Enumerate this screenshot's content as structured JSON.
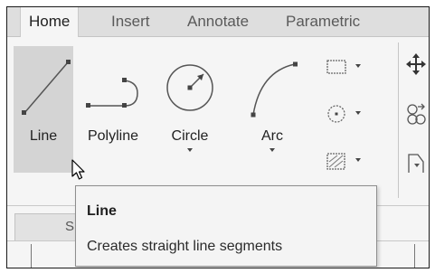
{
  "tabs": [
    {
      "label": "Home",
      "active": true
    },
    {
      "label": "Insert",
      "active": false
    },
    {
      "label": "Annotate",
      "active": false
    },
    {
      "label": "Parametric",
      "active": false
    }
  ],
  "draw_panel": {
    "tools": [
      {
        "label": "Line",
        "icon": "line-icon",
        "has_dropdown": false,
        "hovered": true
      },
      {
        "label": "Polyline",
        "icon": "polyline-icon",
        "has_dropdown": false,
        "hovered": false
      },
      {
        "label": "Circle",
        "icon": "circle-icon",
        "has_dropdown": true,
        "hovered": false
      },
      {
        "label": "Arc",
        "icon": "arc-icon",
        "has_dropdown": true,
        "hovered": false
      }
    ],
    "small_tools": [
      {
        "icon": "rectangle-icon",
        "has_dropdown": true
      },
      {
        "icon": "ellipse-icon",
        "has_dropdown": true
      },
      {
        "icon": "hatch-icon",
        "has_dropdown": true
      }
    ]
  },
  "modify_panel": {
    "icons": [
      "move-icon",
      "copy-icon",
      "stretch-icon"
    ]
  },
  "tooltip": {
    "title": "Line",
    "description": "Creates straight line segments"
  },
  "colors": {
    "ribbon_bg": "#f5f5f5",
    "tabbar_bg": "#dedede",
    "hover_bg": "#d4d4d4",
    "tooltip_bg": "#f4f4f4",
    "icon_stroke": "#555555"
  }
}
